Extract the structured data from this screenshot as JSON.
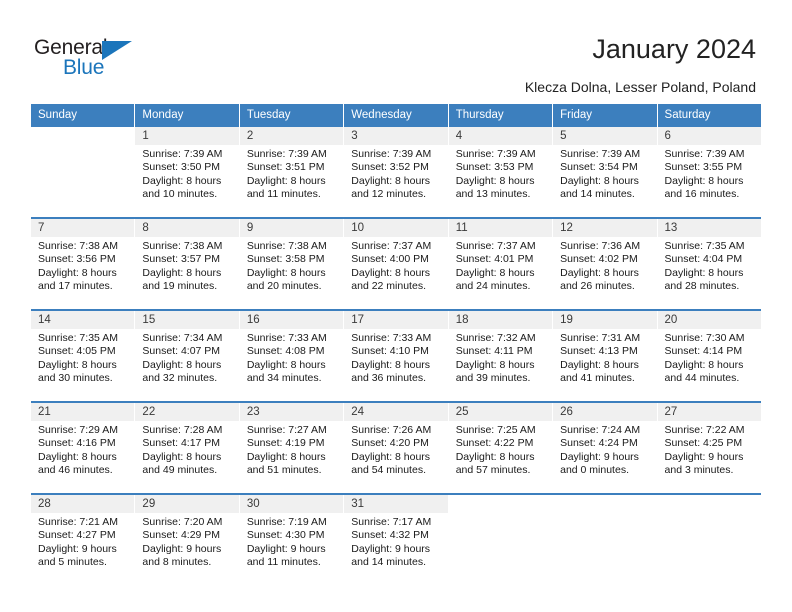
{
  "logo": {
    "word_one": "General",
    "word_two": "Blue",
    "triangle_color": "#1b75bb",
    "text_color": "#231f20"
  },
  "header": {
    "title": "January 2024",
    "subtitle": "Klecza Dolna, Lesser Poland, Poland"
  },
  "theme": {
    "header_blue": "#3c7fbe",
    "day_number_bg": "#f0f0f0"
  },
  "weekdays": [
    "Sunday",
    "Monday",
    "Tuesday",
    "Wednesday",
    "Thursday",
    "Friday",
    "Saturday"
  ],
  "weeks": [
    [
      {
        "day": "",
        "lines": []
      },
      {
        "day": "1",
        "lines": [
          "Sunrise: 7:39 AM",
          "Sunset: 3:50 PM",
          "Daylight: 8 hours",
          "and 10 minutes."
        ]
      },
      {
        "day": "2",
        "lines": [
          "Sunrise: 7:39 AM",
          "Sunset: 3:51 PM",
          "Daylight: 8 hours",
          "and 11 minutes."
        ]
      },
      {
        "day": "3",
        "lines": [
          "Sunrise: 7:39 AM",
          "Sunset: 3:52 PM",
          "Daylight: 8 hours",
          "and 12 minutes."
        ]
      },
      {
        "day": "4",
        "lines": [
          "Sunrise: 7:39 AM",
          "Sunset: 3:53 PM",
          "Daylight: 8 hours",
          "and 13 minutes."
        ]
      },
      {
        "day": "5",
        "lines": [
          "Sunrise: 7:39 AM",
          "Sunset: 3:54 PM",
          "Daylight: 8 hours",
          "and 14 minutes."
        ]
      },
      {
        "day": "6",
        "lines": [
          "Sunrise: 7:39 AM",
          "Sunset: 3:55 PM",
          "Daylight: 8 hours",
          "and 16 minutes."
        ]
      }
    ],
    [
      {
        "day": "7",
        "lines": [
          "Sunrise: 7:38 AM",
          "Sunset: 3:56 PM",
          "Daylight: 8 hours",
          "and 17 minutes."
        ]
      },
      {
        "day": "8",
        "lines": [
          "Sunrise: 7:38 AM",
          "Sunset: 3:57 PM",
          "Daylight: 8 hours",
          "and 19 minutes."
        ]
      },
      {
        "day": "9",
        "lines": [
          "Sunrise: 7:38 AM",
          "Sunset: 3:58 PM",
          "Daylight: 8 hours",
          "and 20 minutes."
        ]
      },
      {
        "day": "10",
        "lines": [
          "Sunrise: 7:37 AM",
          "Sunset: 4:00 PM",
          "Daylight: 8 hours",
          "and 22 minutes."
        ]
      },
      {
        "day": "11",
        "lines": [
          "Sunrise: 7:37 AM",
          "Sunset: 4:01 PM",
          "Daylight: 8 hours",
          "and 24 minutes."
        ]
      },
      {
        "day": "12",
        "lines": [
          "Sunrise: 7:36 AM",
          "Sunset: 4:02 PM",
          "Daylight: 8 hours",
          "and 26 minutes."
        ]
      },
      {
        "day": "13",
        "lines": [
          "Sunrise: 7:35 AM",
          "Sunset: 4:04 PM",
          "Daylight: 8 hours",
          "and 28 minutes."
        ]
      }
    ],
    [
      {
        "day": "14",
        "lines": [
          "Sunrise: 7:35 AM",
          "Sunset: 4:05 PM",
          "Daylight: 8 hours",
          "and 30 minutes."
        ]
      },
      {
        "day": "15",
        "lines": [
          "Sunrise: 7:34 AM",
          "Sunset: 4:07 PM",
          "Daylight: 8 hours",
          "and 32 minutes."
        ]
      },
      {
        "day": "16",
        "lines": [
          "Sunrise: 7:33 AM",
          "Sunset: 4:08 PM",
          "Daylight: 8 hours",
          "and 34 minutes."
        ]
      },
      {
        "day": "17",
        "lines": [
          "Sunrise: 7:33 AM",
          "Sunset: 4:10 PM",
          "Daylight: 8 hours",
          "and 36 minutes."
        ]
      },
      {
        "day": "18",
        "lines": [
          "Sunrise: 7:32 AM",
          "Sunset: 4:11 PM",
          "Daylight: 8 hours",
          "and 39 minutes."
        ]
      },
      {
        "day": "19",
        "lines": [
          "Sunrise: 7:31 AM",
          "Sunset: 4:13 PM",
          "Daylight: 8 hours",
          "and 41 minutes."
        ]
      },
      {
        "day": "20",
        "lines": [
          "Sunrise: 7:30 AM",
          "Sunset: 4:14 PM",
          "Daylight: 8 hours",
          "and 44 minutes."
        ]
      }
    ],
    [
      {
        "day": "21",
        "lines": [
          "Sunrise: 7:29 AM",
          "Sunset: 4:16 PM",
          "Daylight: 8 hours",
          "and 46 minutes."
        ]
      },
      {
        "day": "22",
        "lines": [
          "Sunrise: 7:28 AM",
          "Sunset: 4:17 PM",
          "Daylight: 8 hours",
          "and 49 minutes."
        ]
      },
      {
        "day": "23",
        "lines": [
          "Sunrise: 7:27 AM",
          "Sunset: 4:19 PM",
          "Daylight: 8 hours",
          "and 51 minutes."
        ]
      },
      {
        "day": "24",
        "lines": [
          "Sunrise: 7:26 AM",
          "Sunset: 4:20 PM",
          "Daylight: 8 hours",
          "and 54 minutes."
        ]
      },
      {
        "day": "25",
        "lines": [
          "Sunrise: 7:25 AM",
          "Sunset: 4:22 PM",
          "Daylight: 8 hours",
          "and 57 minutes."
        ]
      },
      {
        "day": "26",
        "lines": [
          "Sunrise: 7:24 AM",
          "Sunset: 4:24 PM",
          "Daylight: 9 hours",
          "and 0 minutes."
        ]
      },
      {
        "day": "27",
        "lines": [
          "Sunrise: 7:22 AM",
          "Sunset: 4:25 PM",
          "Daylight: 9 hours",
          "and 3 minutes."
        ]
      }
    ],
    [
      {
        "day": "28",
        "lines": [
          "Sunrise: 7:21 AM",
          "Sunset: 4:27 PM",
          "Daylight: 9 hours",
          "and 5 minutes."
        ]
      },
      {
        "day": "29",
        "lines": [
          "Sunrise: 7:20 AM",
          "Sunset: 4:29 PM",
          "Daylight: 9 hours",
          "and 8 minutes."
        ]
      },
      {
        "day": "30",
        "lines": [
          "Sunrise: 7:19 AM",
          "Sunset: 4:30 PM",
          "Daylight: 9 hours",
          "and 11 minutes."
        ]
      },
      {
        "day": "31",
        "lines": [
          "Sunrise: 7:17 AM",
          "Sunset: 4:32 PM",
          "Daylight: 9 hours",
          "and 14 minutes."
        ]
      },
      {
        "day": "",
        "lines": []
      },
      {
        "day": "",
        "lines": []
      },
      {
        "day": "",
        "lines": []
      }
    ]
  ]
}
